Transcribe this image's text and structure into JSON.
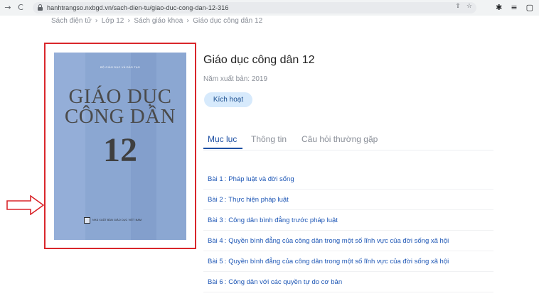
{
  "browser": {
    "back_icon": "→",
    "reload_icon": "C",
    "url": "hanhtrangso.nxbgd.vn/sach-dien-tu/giao-duc-cong-dan-12-316"
  },
  "breadcrumb": [
    "Sách điện tử",
    "Lớp 12",
    "Sách giáo khoa",
    "Giáo dục công dân 12"
  ],
  "cover": {
    "publisher_top": "BỘ GIÁO DỤC VÀ ĐÀO TẠO",
    "title_line1": "GIÁO DỤC",
    "title_line2": "CÔNG DÂN",
    "grade": "12",
    "publisher_bottom": "NHÀ XUẤT BẢN GIÁO DỤC VIỆT NAM"
  },
  "book": {
    "title": "Giáo dục công dân 12",
    "year": "Năm xuất bản: 2019",
    "activate_label": "Kích hoạt"
  },
  "tabs": [
    {
      "label": "Mục lục",
      "active": true
    },
    {
      "label": "Thông tin",
      "active": false
    },
    {
      "label": "Câu hỏi thường gặp",
      "active": false
    }
  ],
  "lessons": [
    {
      "num": "Bài 1",
      "title": "Pháp luật và đời sống"
    },
    {
      "num": "Bài 2",
      "title": "Thực hiện pháp luật"
    },
    {
      "num": "Bài 3",
      "title": "Công dân bình đẳng trước pháp luật"
    },
    {
      "num": "Bài 4",
      "title": "Quyền bình đẳng của công dân trong một số lĩnh vực của đời sống xã hội"
    },
    {
      "num": "Bài 5",
      "title": "Quyền bình đẳng của công dân trong một số lĩnh vực của đời sống xã hội"
    },
    {
      "num": "Bài 6",
      "title": "Công dân với các quyền tự do cơ bản"
    }
  ],
  "colors": {
    "accent": "#1d4fa3",
    "highlight": "#d9262b",
    "cover_bg": "#8ba7d2"
  },
  "icons": {
    "share": "share-icon",
    "star": "star-icon",
    "extensions": "puzzle-icon",
    "reading_list": "reading-list-icon",
    "sidebar": "sidebar-icon"
  }
}
